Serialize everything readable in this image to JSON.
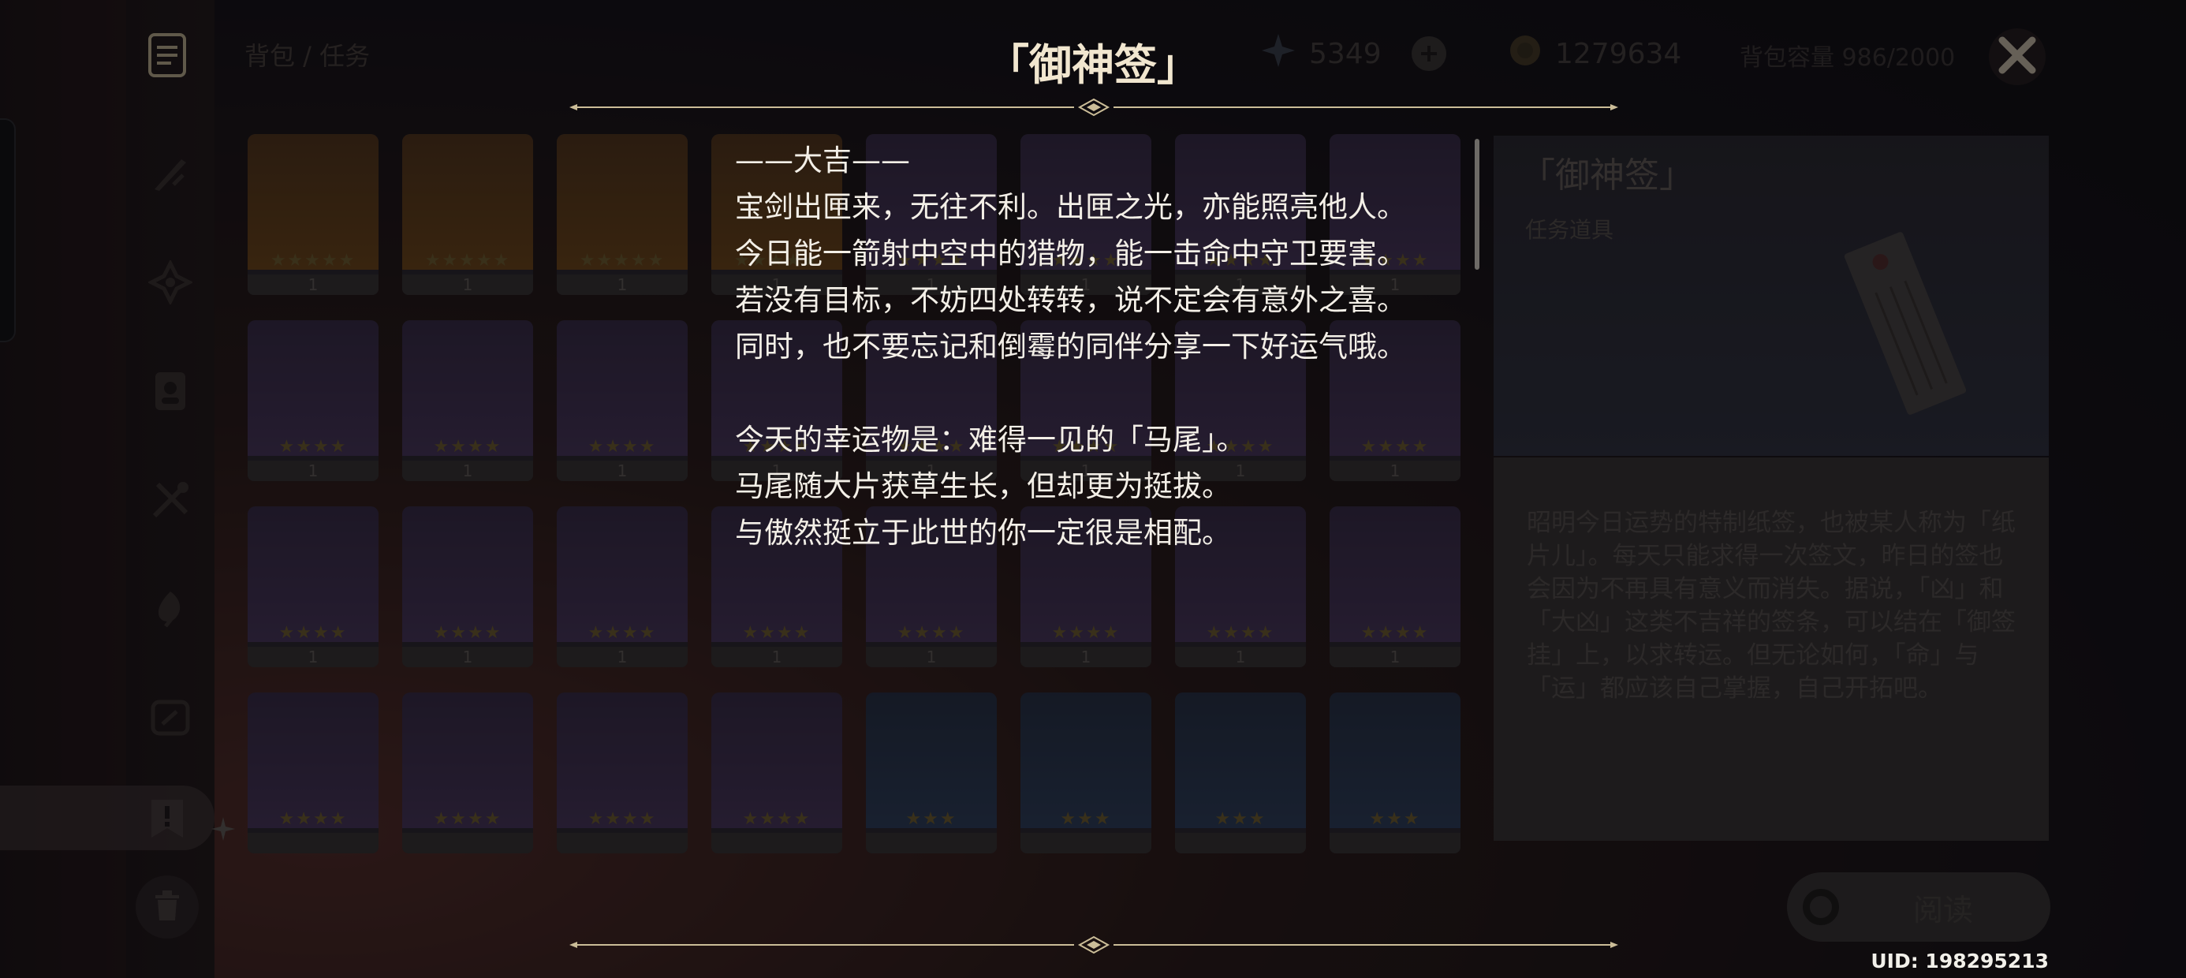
{
  "header": {
    "breadcrumb": "背包 / 任务",
    "primogems": "5349",
    "mora": "1279634",
    "capacity": "背包容量 986/2000"
  },
  "dialog": {
    "title": "「御神签」",
    "fortune_lines": [
      "——大吉——",
      "宝剑出匣来，无往不利。出匣之光，亦能照亮他人。",
      "今日能一箭射中空中的猎物，能一击命中守卫要害。",
      "若没有目标，不妨四处转转，说不定会有意外之喜。",
      "同时，也不要忘记和倒霉的同伴分享一下好运气哦。",
      "",
      "今天的幸运物是：难得一见的「马尾」。",
      "马尾随大片获草生长，但却更为挺拔。",
      "与傲然挺立于此世的你一定很是相配。"
    ]
  },
  "detail": {
    "title": "「御神签」",
    "type": "任务道具",
    "description": "昭明今日运势的特制纸签，也被某人称为「纸片儿」。每天只能求得一次签文，昨日的签也会因为不再具有意义而消失。据说，「凶」和「大凶」这类不吉祥的签条，可以结在「御签挂」上，以求转运。但无论如何，「命」与「运」都应该自己掌握，自己开拓吧。",
    "read_label": "阅读"
  },
  "uid": "UID: 198295213",
  "grid": {
    "rows": [
      [
        {
          "rarity": 5,
          "count": "1"
        },
        {
          "rarity": 5,
          "count": "1"
        },
        {
          "rarity": 5,
          "count": "1"
        },
        {
          "rarity": 5,
          "count": "1"
        },
        {
          "rarity": 4,
          "count": "1"
        },
        {
          "rarity": 4,
          "count": "1"
        },
        {
          "rarity": 4,
          "count": "1"
        },
        {
          "rarity": 4,
          "count": "1"
        }
      ],
      [
        {
          "rarity": 4,
          "count": "1"
        },
        {
          "rarity": 4,
          "count": "1"
        },
        {
          "rarity": 4,
          "count": "1"
        },
        {
          "rarity": 4,
          "count": "1"
        },
        {
          "rarity": 4,
          "count": "1"
        },
        {
          "rarity": 4,
          "count": "1"
        },
        {
          "rarity": 4,
          "count": "1"
        },
        {
          "rarity": 4,
          "count": "1"
        }
      ],
      [
        {
          "rarity": 4,
          "count": "1"
        },
        {
          "rarity": 4,
          "count": "1"
        },
        {
          "rarity": 4,
          "count": "1"
        },
        {
          "rarity": 4,
          "count": "1"
        },
        {
          "rarity": 4,
          "count": "1"
        },
        {
          "rarity": 4,
          "count": "1"
        },
        {
          "rarity": 4,
          "count": "1"
        },
        {
          "rarity": 4,
          "count": "1"
        }
      ],
      [
        {
          "rarity": 4,
          "count": ""
        },
        {
          "rarity": 4,
          "count": ""
        },
        {
          "rarity": 4,
          "count": ""
        },
        {
          "rarity": 4,
          "count": ""
        },
        {
          "rarity": 3,
          "count": ""
        },
        {
          "rarity": 3,
          "count": ""
        },
        {
          "rarity": 3,
          "count": ""
        },
        {
          "rarity": 3,
          "count": ""
        }
      ]
    ]
  },
  "colors": {
    "accent_gold": "#d8c79a",
    "text_cream": "#f3efe7"
  }
}
